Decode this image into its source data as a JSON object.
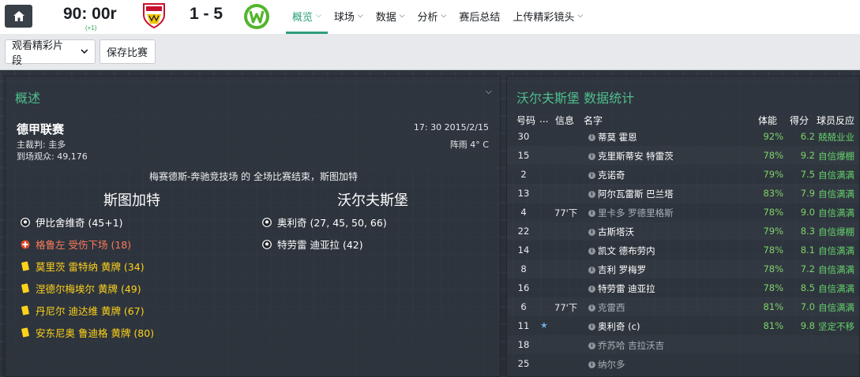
{
  "header": {
    "clock": "90: 00r",
    "clock_extra": "(+1)",
    "score": "1 - 5",
    "nav": [
      {
        "label": "概览",
        "active": true,
        "dropdown": true
      },
      {
        "label": "球场",
        "active": false,
        "dropdown": true
      },
      {
        "label": "数据",
        "active": false,
        "dropdown": true
      },
      {
        "label": "分析",
        "active": false,
        "dropdown": true
      },
      {
        "label": "赛后总结",
        "active": false,
        "dropdown": false
      },
      {
        "label": "上传精彩镜头",
        "active": false,
        "dropdown": true
      }
    ]
  },
  "toolbar": {
    "highlights_label": "观看精彩片段",
    "save_label": "保存比赛"
  },
  "overview": {
    "title": "概述",
    "competition": "德甲联赛",
    "referee": "主裁判: 圭多",
    "attendance": "到场观众: 49,176",
    "datetime": "17: 30 2015/2/15",
    "weather": "阵雨 4° C",
    "result_text": "梅赛德斯-奔驰竞技场 的 全场比赛结束，斯图加特",
    "home_team": "斯图加特",
    "away_team": "沃尔夫斯堡",
    "home_events": [
      {
        "type": "goal",
        "text": "伊比舍维奇 (45+1)"
      },
      {
        "type": "injury",
        "text": "格鲁左 受伤下场 (18)"
      },
      {
        "type": "yellow",
        "text": "莫里茨 雷特纳 黄牌 (34)"
      },
      {
        "type": "yellow",
        "text": "涅德尔梅埃尔 黄牌 (49)"
      },
      {
        "type": "yellow",
        "text": "丹尼尔 迪达维 黄牌 (67)"
      },
      {
        "type": "yellow",
        "text": "安东尼奥 鲁迪格 黄牌 (80)"
      }
    ],
    "away_events": [
      {
        "type": "goal",
        "text": "奥利奇 (27, 45, 50, 66)"
      },
      {
        "type": "goal",
        "text": "特劳雷 迪亚拉 (42)"
      }
    ]
  },
  "stats": {
    "title": "沃尔夫斯堡 数据统计",
    "columns": {
      "num": "号码",
      "dots": "...",
      "info": "信息",
      "name": "名字",
      "condition": "体能",
      "rating": "得分",
      "reaction": "球员反应"
    },
    "players": [
      {
        "num": "30",
        "info": "",
        "name": "蒂莫 霍恩",
        "condition": "92%",
        "rating": "6.2",
        "reaction": "兢兢业业",
        "sub": false,
        "star": false
      },
      {
        "num": "15",
        "info": "",
        "name": "克里斯蒂安 特雷茨",
        "condition": "78%",
        "rating": "9.2",
        "reaction": "自信爆棚",
        "sub": false,
        "star": false
      },
      {
        "num": "2",
        "info": "",
        "name": "克诺奇",
        "condition": "79%",
        "rating": "7.5",
        "reaction": "自信满满",
        "sub": false,
        "star": false
      },
      {
        "num": "13",
        "info": "",
        "name": "阿尔瓦雷斯 巴兰塔",
        "condition": "83%",
        "rating": "7.9",
        "reaction": "自信满满",
        "sub": false,
        "star": false
      },
      {
        "num": "4",
        "info": "77'下",
        "name": "里卡多 罗德里格斯",
        "condition": "78%",
        "rating": "9.0",
        "reaction": "自信满满",
        "sub": true,
        "star": false
      },
      {
        "num": "22",
        "info": "",
        "name": "古斯塔沃",
        "condition": "79%",
        "rating": "8.3",
        "reaction": "自信爆棚",
        "sub": false,
        "star": false
      },
      {
        "num": "14",
        "info": "",
        "name": "凯文 德布劳内",
        "condition": "78%",
        "rating": "8.1",
        "reaction": "自信满满",
        "sub": false,
        "star": false
      },
      {
        "num": "8",
        "info": "",
        "name": "吉利 罗梅罗",
        "condition": "78%",
        "rating": "7.2",
        "reaction": "自信满满",
        "sub": false,
        "star": false
      },
      {
        "num": "16",
        "info": "",
        "name": "特劳雷 迪亚拉",
        "condition": "78%",
        "rating": "8.5",
        "reaction": "自信满满",
        "sub": false,
        "star": false
      },
      {
        "num": "6",
        "info": "77'下",
        "name": "克雷西",
        "condition": "81%",
        "rating": "7.0",
        "reaction": "自信满满",
        "sub": true,
        "star": false
      },
      {
        "num": "11",
        "info": "",
        "name": "奥利奇 (c)",
        "condition": "81%",
        "rating": "9.8",
        "reaction": "坚定不移",
        "sub": false,
        "star": true
      },
      {
        "num": "18",
        "info": "",
        "name": "乔苏哈 吉拉沃吉",
        "condition": "",
        "rating": "",
        "reaction": "",
        "sub": true,
        "star": false
      },
      {
        "num": "25",
        "info": "",
        "name": "纳尔多",
        "condition": "",
        "rating": "",
        "reaction": "",
        "sub": true,
        "star": false
      }
    ]
  }
}
